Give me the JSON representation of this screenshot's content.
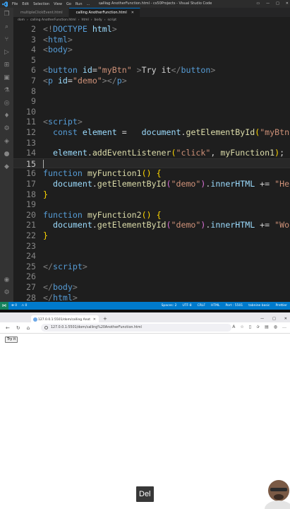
{
  "vscode": {
    "menu": [
      "File",
      "Edit",
      "Selection",
      "View",
      "Go",
      "Run",
      "..."
    ],
    "window_title": "calling AnotherFunction.html - cs50Projects - Visual Studio Code",
    "tabs": [
      {
        "label": "multipleClickEvent.html",
        "active": false
      },
      {
        "label": "calling AnotherFunction.html",
        "active": true
      }
    ],
    "breadcrumb": [
      "dom",
      "calling AnotherFunction.html",
      "html",
      "body",
      "script"
    ],
    "lines": [
      {
        "n": "2",
        "tokens": [
          [
            "t-brk",
            "<!"
          ],
          [
            "t-tag",
            "DOCTYPE"
          ],
          [
            "t-txt",
            " "
          ],
          [
            "t-attr",
            "html"
          ],
          [
            "t-brk",
            ">"
          ]
        ]
      },
      {
        "n": "3",
        "tokens": [
          [
            "t-brk",
            "<"
          ],
          [
            "t-tag",
            "html"
          ],
          [
            "t-brk",
            ">"
          ]
        ]
      },
      {
        "n": "4",
        "tokens": [
          [
            "t-brk",
            "<"
          ],
          [
            "t-tag",
            "body"
          ],
          [
            "t-brk",
            ">"
          ]
        ]
      },
      {
        "n": "5",
        "tokens": []
      },
      {
        "n": "6",
        "tokens": [
          [
            "t-brk",
            "<"
          ],
          [
            "t-tag",
            "button"
          ],
          [
            "t-txt",
            " "
          ],
          [
            "t-attr",
            "id"
          ],
          [
            "t-txt",
            "="
          ],
          [
            "t-str",
            "\"myBtn\""
          ],
          [
            "t-txt",
            " "
          ],
          [
            "t-brk",
            ">"
          ],
          [
            "t-txt",
            "Try it"
          ],
          [
            "t-brk",
            "</"
          ],
          [
            "t-tag",
            "button"
          ],
          [
            "t-brk",
            ">"
          ]
        ]
      },
      {
        "n": "7",
        "tokens": [
          [
            "t-brk",
            "<"
          ],
          [
            "t-tag",
            "p"
          ],
          [
            "t-txt",
            " "
          ],
          [
            "t-attr",
            "id"
          ],
          [
            "t-txt",
            "="
          ],
          [
            "t-str",
            "\"demo\""
          ],
          [
            "t-brk",
            "></"
          ],
          [
            "t-tag",
            "p"
          ],
          [
            "t-brk",
            ">"
          ]
        ]
      },
      {
        "n": "8",
        "tokens": []
      },
      {
        "n": "9",
        "tokens": []
      },
      {
        "n": "10",
        "tokens": []
      },
      {
        "n": "11",
        "tokens": [
          [
            "t-brk",
            "<"
          ],
          [
            "t-tag",
            "script"
          ],
          [
            "t-brk",
            ">"
          ]
        ]
      },
      {
        "n": "12",
        "tokens": [
          [
            "t-txt",
            "  "
          ],
          [
            "t-kw",
            "const"
          ],
          [
            "t-txt",
            " "
          ],
          [
            "t-var",
            "element"
          ],
          [
            "t-txt",
            " =   "
          ],
          [
            "t-var",
            "document"
          ],
          [
            "t-txt",
            "."
          ],
          [
            "t-fn",
            "getElementById"
          ],
          [
            "t-br1",
            "("
          ],
          [
            "t-str",
            "\"myBtn\""
          ],
          [
            "t-br1",
            ")"
          ],
          [
            "t-txt",
            ";"
          ]
        ]
      },
      {
        "n": "13",
        "tokens": []
      },
      {
        "n": "14",
        "tokens": [
          [
            "t-txt",
            "  "
          ],
          [
            "t-var",
            "element"
          ],
          [
            "t-txt",
            "."
          ],
          [
            "t-fn",
            "addEventListener"
          ],
          [
            "t-br1",
            "("
          ],
          [
            "t-str",
            "\"click\""
          ],
          [
            "t-txt",
            ", "
          ],
          [
            "t-fn",
            "myFunction1"
          ],
          [
            "t-br1",
            ")"
          ],
          [
            "t-txt",
            ";"
          ]
        ]
      },
      {
        "n": "15",
        "tokens": [],
        "current": true
      },
      {
        "n": "16",
        "tokens": [
          [
            "t-kw",
            "function"
          ],
          [
            "t-txt",
            " "
          ],
          [
            "t-fn",
            "myFunction1"
          ],
          [
            "t-br1",
            "()"
          ],
          [
            "t-txt",
            " "
          ],
          [
            "t-br1",
            "{"
          ]
        ]
      },
      {
        "n": "17",
        "tokens": [
          [
            "t-txt",
            "  "
          ],
          [
            "t-var",
            "document"
          ],
          [
            "t-txt",
            "."
          ],
          [
            "t-fn",
            "getElementById"
          ],
          [
            "t-br2",
            "("
          ],
          [
            "t-str",
            "\"demo\""
          ],
          [
            "t-br2",
            ")"
          ],
          [
            "t-txt",
            "."
          ],
          [
            "t-var",
            "innerHTML"
          ],
          [
            "t-txt",
            " += "
          ],
          [
            "t-str",
            "\"Hello \""
          ]
        ]
      },
      {
        "n": "18",
        "tokens": [
          [
            "t-br1",
            "}"
          ]
        ]
      },
      {
        "n": "19",
        "tokens": []
      },
      {
        "n": "20",
        "tokens": [
          [
            "t-kw",
            "function"
          ],
          [
            "t-txt",
            " "
          ],
          [
            "t-fn",
            "myFunction2"
          ],
          [
            "t-br1",
            "()"
          ],
          [
            "t-txt",
            " "
          ],
          [
            "t-br1",
            "{"
          ]
        ]
      },
      {
        "n": "21",
        "tokens": [
          [
            "t-txt",
            "  "
          ],
          [
            "t-var",
            "document"
          ],
          [
            "t-txt",
            "."
          ],
          [
            "t-fn",
            "getElementById"
          ],
          [
            "t-br2",
            "("
          ],
          [
            "t-str",
            "\"demo\""
          ],
          [
            "t-br2",
            ")"
          ],
          [
            "t-txt",
            "."
          ],
          [
            "t-var",
            "innerHTML"
          ],
          [
            "t-txt",
            " += "
          ],
          [
            "t-str",
            "\"World !\""
          ]
        ]
      },
      {
        "n": "22",
        "tokens": [
          [
            "t-br1",
            "}"
          ]
        ]
      },
      {
        "n": "23",
        "tokens": []
      },
      {
        "n": "24",
        "tokens": []
      },
      {
        "n": "25",
        "tokens": [
          [
            "t-brk",
            "</"
          ],
          [
            "t-tag",
            "script"
          ],
          [
            "t-brk",
            ">"
          ]
        ]
      },
      {
        "n": "26",
        "tokens": []
      },
      {
        "n": "27",
        "tokens": [
          [
            "t-brk",
            "</"
          ],
          [
            "t-tag",
            "body"
          ],
          [
            "t-brk",
            ">"
          ]
        ]
      },
      {
        "n": "28",
        "tokens": [
          [
            "t-brk",
            "</"
          ],
          [
            "t-tag",
            "html"
          ],
          [
            "t-brk",
            ">"
          ]
        ]
      }
    ],
    "status_left": [
      "⊗ 0",
      "⚠ 0"
    ],
    "status_right": [
      "Spaces: 2",
      "UTF-8",
      "CRLF",
      "HTML",
      "Port : 5501",
      "tabnine basic",
      "Prettier"
    ]
  },
  "browser": {
    "tab_title": "127.0.0.1:5501/dom/calling Anot",
    "url": "127.0.0.1:5501/dom/calling%20AnotherFunction.html",
    "page_button": "Try it"
  },
  "caption": "Del",
  "colors": {
    "accent": "#007acc",
    "editor_bg": "#1e1e1e"
  }
}
